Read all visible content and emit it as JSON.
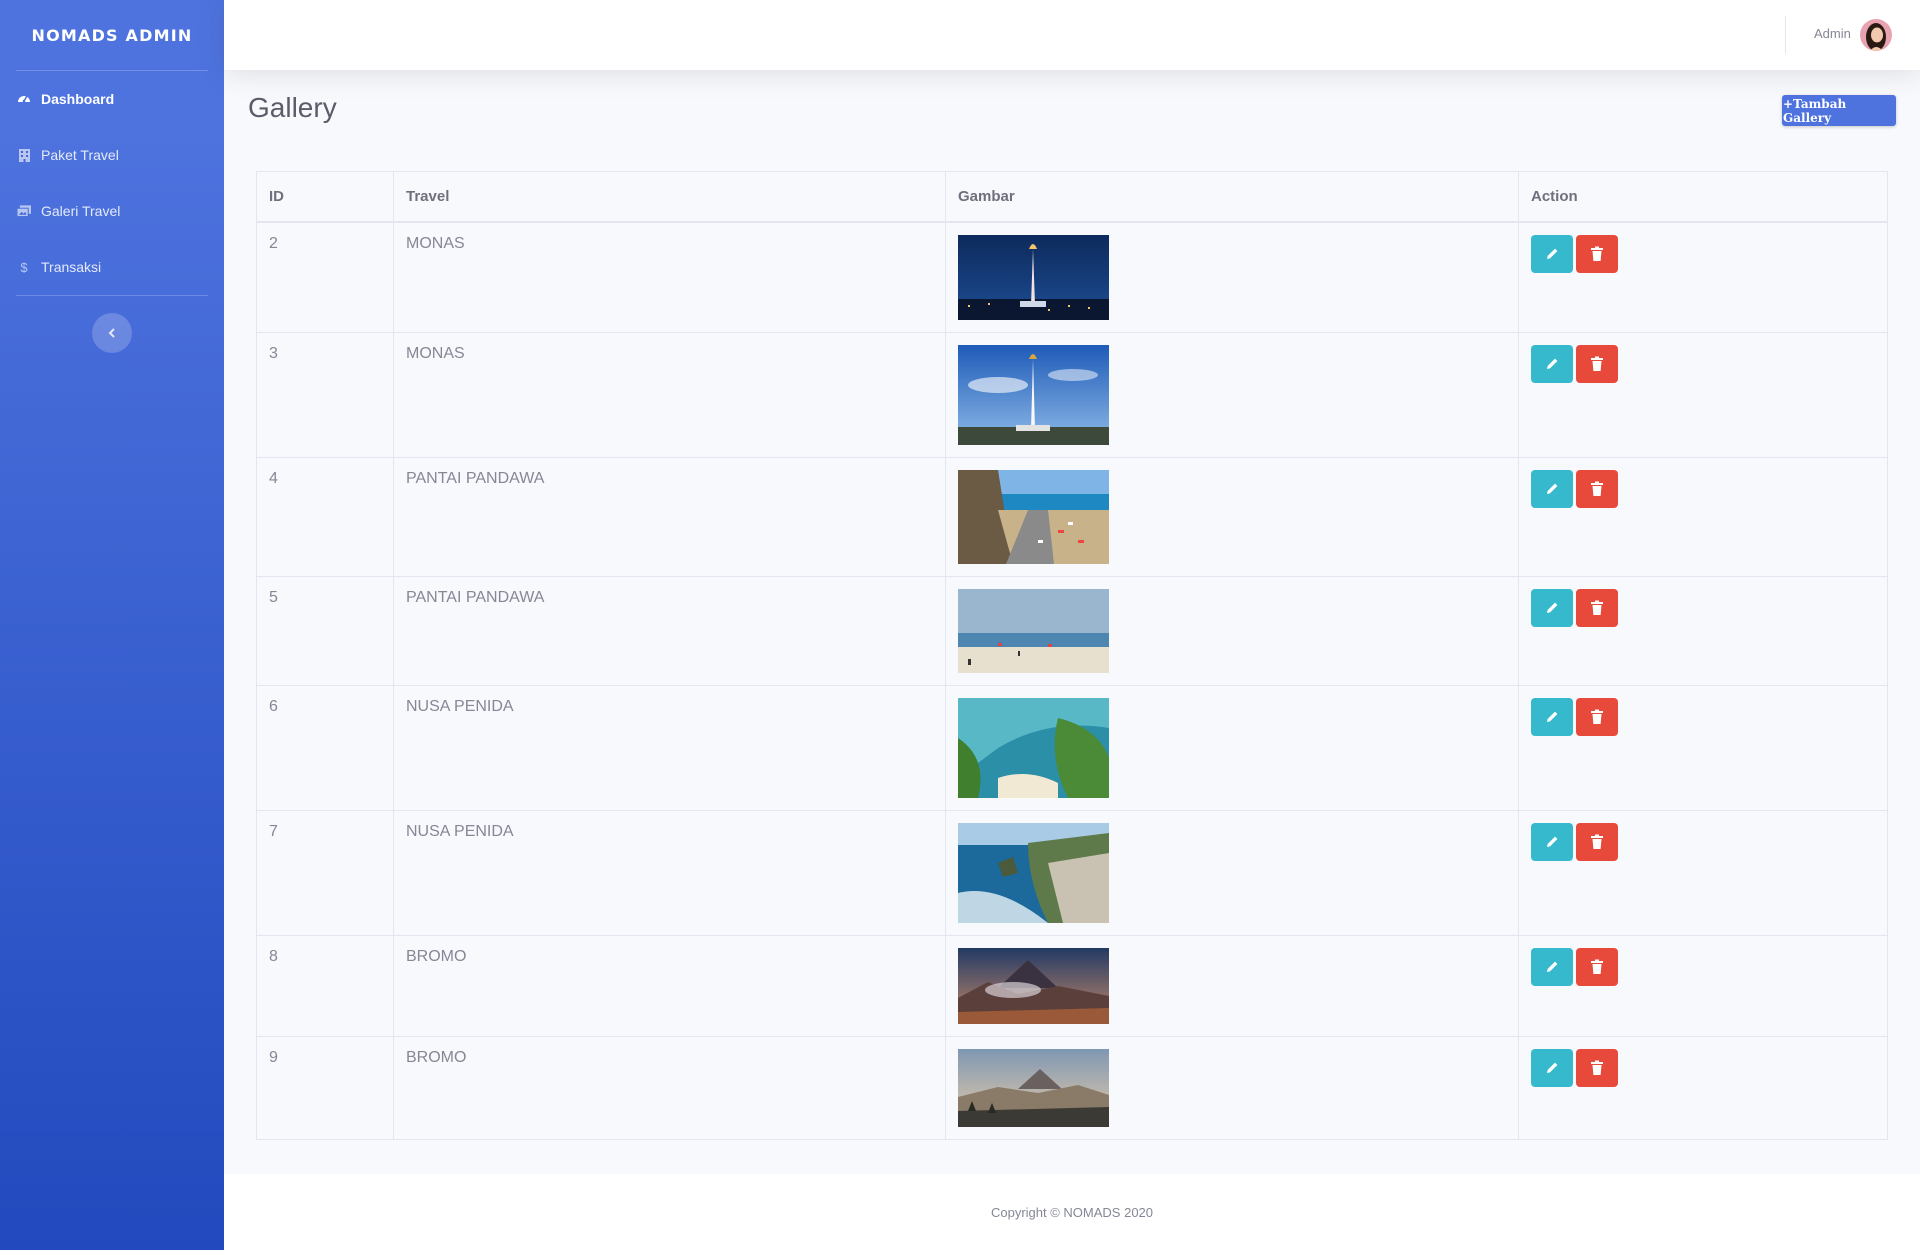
{
  "sidebar": {
    "brand": "NOMADS ADMIN",
    "items": [
      {
        "label": "Dashboard",
        "icon": "tachometer-icon"
      },
      {
        "label": "Paket Travel",
        "icon": "building-icon"
      },
      {
        "label": "Galeri Travel",
        "icon": "images-icon"
      },
      {
        "label": "Transaksi",
        "icon": "dollar-icon"
      }
    ]
  },
  "topbar": {
    "user_name": "Admin"
  },
  "page": {
    "title": "Gallery",
    "add_button": "+Tambah Gallery"
  },
  "table": {
    "headers": [
      "ID",
      "Travel",
      "Gambar",
      "Action"
    ],
    "rows": [
      {
        "id": "2",
        "travel": "MONAS",
        "image": "monas-night"
      },
      {
        "id": "3",
        "travel": "MONAS",
        "image": "monas-day"
      },
      {
        "id": "4",
        "travel": "PANTAI PANDAWA",
        "image": "pandawa-road"
      },
      {
        "id": "5",
        "travel": "PANTAI PANDAWA",
        "image": "pandawa-beach"
      },
      {
        "id": "6",
        "travel": "NUSA PENIDA",
        "image": "penida-kelingking"
      },
      {
        "id": "7",
        "travel": "NUSA PENIDA",
        "image": "penida-cliffs"
      },
      {
        "id": "8",
        "travel": "BROMO",
        "image": "bromo-dawn"
      },
      {
        "id": "9",
        "travel": "BROMO",
        "image": "bromo-morning"
      }
    ]
  },
  "footer": {
    "copyright": "Copyright © NOMADS 2020"
  },
  "colors": {
    "primary": "#4e73df",
    "info": "#36b9cc",
    "danger": "#e74a3b"
  }
}
